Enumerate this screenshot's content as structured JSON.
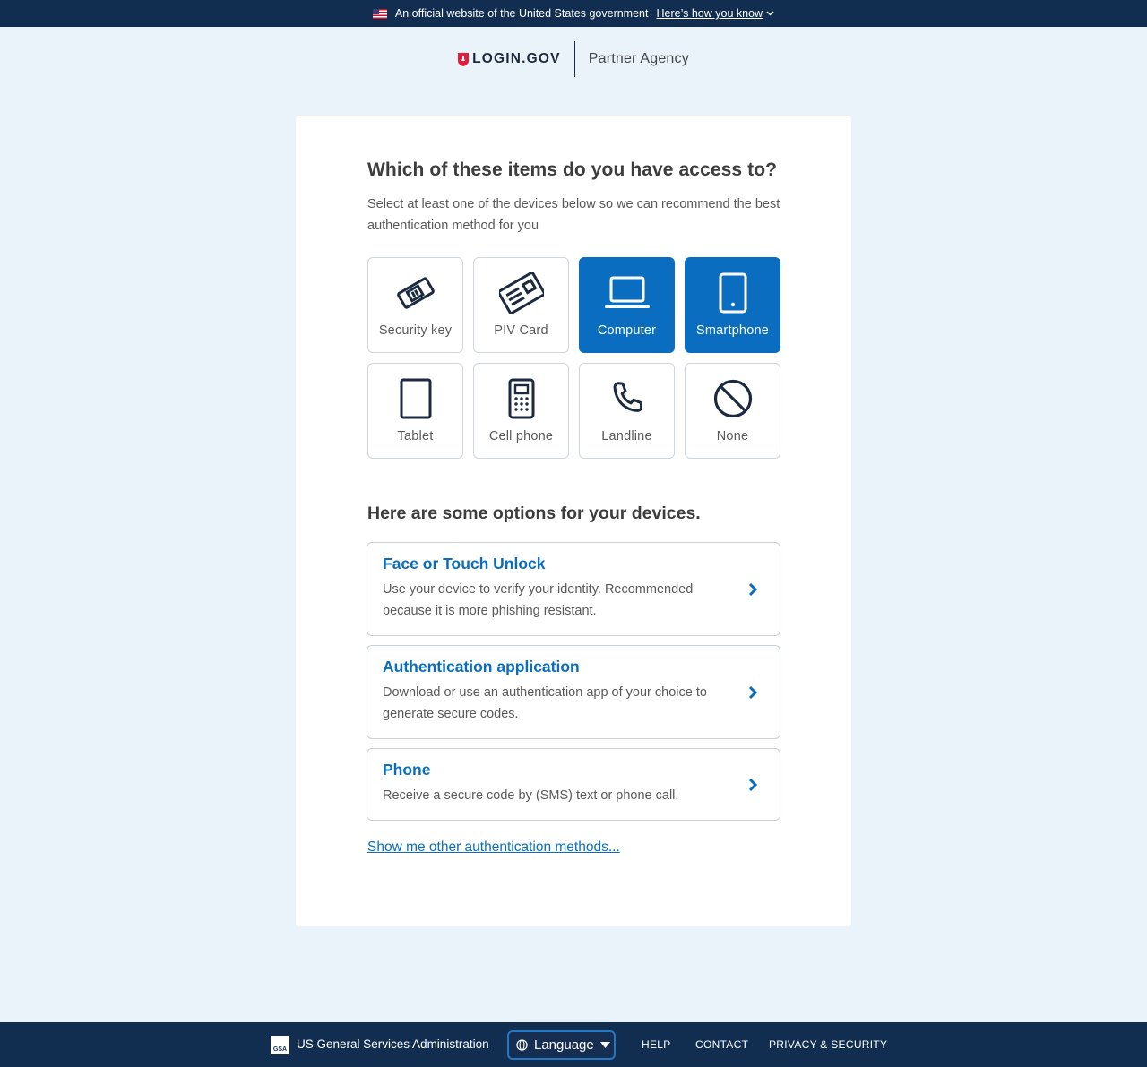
{
  "gov_banner": {
    "official_text": "An official website of the United States government",
    "how_you_know": "Here’s how you know"
  },
  "header": {
    "logo_text": "LOGIN.GOV",
    "partner": "Partner Agency"
  },
  "main": {
    "heading": "Which of these items do you have access to?",
    "lead": "Select at least one of the devices below so we can recommend the best authentication method for you",
    "devices": [
      {
        "label": "Security key",
        "icon": "security-key-icon",
        "selected": false
      },
      {
        "label": "PIV Card",
        "icon": "piv-card-icon",
        "selected": false
      },
      {
        "label": "Computer",
        "icon": "laptop-icon",
        "selected": true
      },
      {
        "label": "Smartphone",
        "icon": "smartphone-icon",
        "selected": true
      },
      {
        "label": "Tablet",
        "icon": "tablet-icon",
        "selected": false
      },
      {
        "label": "Cell phone",
        "icon": "cell-phone-icon",
        "selected": false
      },
      {
        "label": "Landline",
        "icon": "landline-icon",
        "selected": false
      },
      {
        "label": "None",
        "icon": "none-icon",
        "selected": false
      }
    ],
    "options_heading": "Here are some options for your devices.",
    "options": [
      {
        "title": "Face or Touch Unlock",
        "description": "Use your device to verify your identity. Recommended because it is more phishing resistant."
      },
      {
        "title": "Authentication application",
        "description": "Download or use an authentication app of your choice to generate secure codes."
      },
      {
        "title": "Phone",
        "description": "Receive a secure code by (SMS) text or phone call."
      }
    ],
    "other_methods_link": "Show me other authentication methods..."
  },
  "footer": {
    "gsa_logo_text": "GSA",
    "agency": "US General Services Administration",
    "language": "Language",
    "links": [
      "HELP",
      "CONTACT",
      "PRIVACY & SECURITY"
    ]
  },
  "colors": {
    "banner_bg": "#112e51",
    "page_bg": "#eaf2fa",
    "accent": "#0a6dbf",
    "logo_red": "#e21c3d"
  }
}
